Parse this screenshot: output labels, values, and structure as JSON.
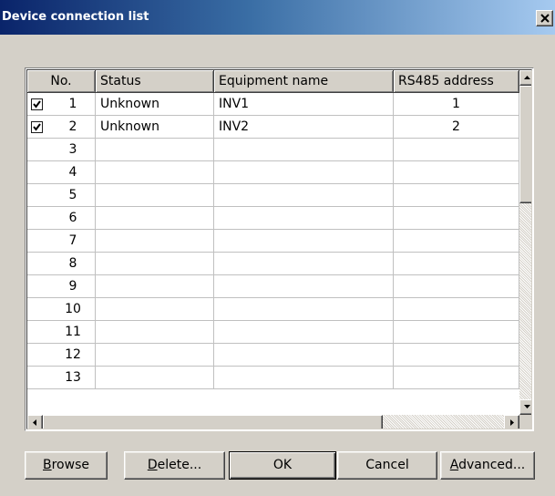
{
  "window": {
    "title": "Device connection list"
  },
  "table": {
    "columns": [
      "No.",
      "Status",
      "Equipment name",
      "RS485 address"
    ],
    "rows": [
      {
        "checked": true,
        "no": "1",
        "status": "Unknown",
        "name": "INV1",
        "address": "1"
      },
      {
        "checked": true,
        "no": "2",
        "status": "Unknown",
        "name": "INV2",
        "address": "2"
      },
      {
        "checked": false,
        "no": "3",
        "status": "",
        "name": "",
        "address": ""
      },
      {
        "checked": false,
        "no": "4",
        "status": "",
        "name": "",
        "address": ""
      },
      {
        "checked": false,
        "no": "5",
        "status": "",
        "name": "",
        "address": ""
      },
      {
        "checked": false,
        "no": "6",
        "status": "",
        "name": "",
        "address": ""
      },
      {
        "checked": false,
        "no": "7",
        "status": "",
        "name": "",
        "address": ""
      },
      {
        "checked": false,
        "no": "8",
        "status": "",
        "name": "",
        "address": ""
      },
      {
        "checked": false,
        "no": "9",
        "status": "",
        "name": "",
        "address": ""
      },
      {
        "checked": false,
        "no": "10",
        "status": "",
        "name": "",
        "address": ""
      },
      {
        "checked": false,
        "no": "11",
        "status": "",
        "name": "",
        "address": ""
      },
      {
        "checked": false,
        "no": "12",
        "status": "",
        "name": "",
        "address": ""
      },
      {
        "checked": false,
        "no": "13",
        "status": "",
        "name": "",
        "address": ""
      }
    ]
  },
  "buttons": {
    "browse": {
      "accel": "B",
      "rest": "rowse"
    },
    "delete": {
      "accel": "D",
      "rest": "elete..."
    },
    "ok": "OK",
    "cancel": "Cancel",
    "advanced": {
      "accel": "A",
      "rest": "dvanced..."
    }
  },
  "colors": {
    "title_start": "#0a246a",
    "title_end": "#a6caf0",
    "face": "#d4d0c8"
  },
  "icons": [
    "close-icon",
    "checkmark-icon",
    "arrow-up-icon",
    "arrow-down-icon",
    "arrow-left-icon",
    "arrow-right-icon"
  ]
}
